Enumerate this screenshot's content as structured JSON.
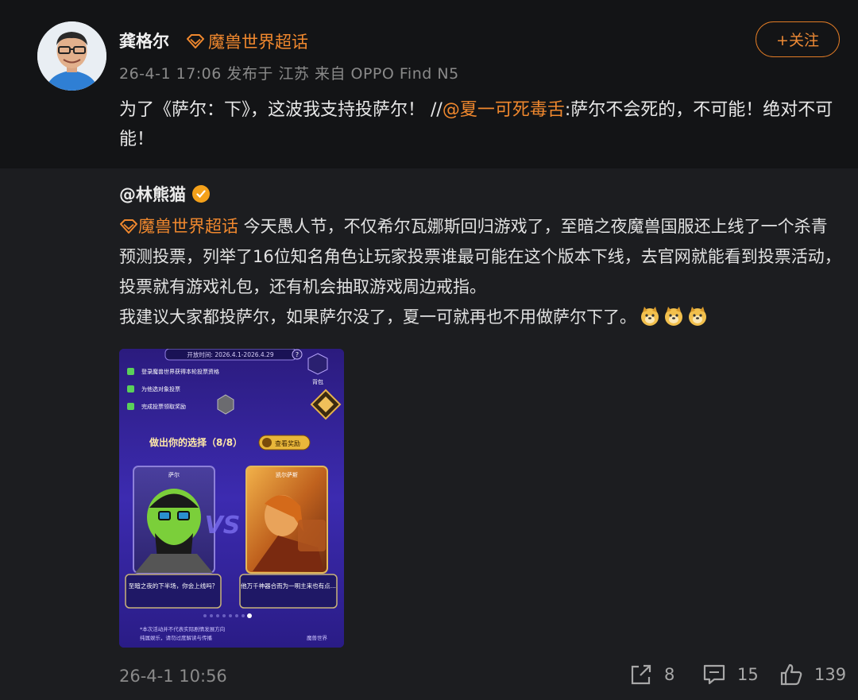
{
  "post": {
    "author": "龚格尔",
    "topic_badge": "魔兽世界超话",
    "meta": "26-4-1 17:06 发布于 江苏 来自 OPPO Find N5",
    "follow_label": "+关注",
    "text_prefix": "为了《萨尔：下》，这波我支持投萨尔！ //",
    "mention": "@夏一可死毒舌",
    "text_suffix": ":萨尔不会死的，不可能！绝对不可能！"
  },
  "repost": {
    "author": "@林熊猫",
    "topic": "魔兽世界超话",
    "text_1": " 今天愚人节，不仅希尔瓦娜斯回归游戏了，至暗之夜魔兽国服还上线了一个杀青预测投票，列举了16位知名角色让玩家投票谁最可能在这个版本下线，去官网就能看到投票活动，投票就有游戏礼包，还有机会抽取游戏周边戒指。",
    "text_2": "我建议大家都投萨尔，如果萨尔没了，夏一可就再也不用做萨尔下了。",
    "emoji_name": "doge-emoji",
    "time": "26-4-1 10:56",
    "actions": {
      "share_count": "8",
      "comment_count": "15",
      "like_count": "139"
    },
    "image": {
      "date_range": "开放时间: 2026.4.1-2026.4.29",
      "tasks": [
        "登录魔兽世界获得本轮投票资格",
        "为他选对象投票",
        "完成投票领取奖励"
      ],
      "title": "做出你的选择（8/8）",
      "back_btn": "查看奖励",
      "left_card": "萨尔",
      "right_card": "凯尔萨斯",
      "left_caption": "至暗之夜的下半场，你会上线吗？",
      "right_caption": "他万千神器合而为一明主来也有点...",
      "right_label": "背包",
      "note": "*本次活动并不代表实际剧情发展方向",
      "note2": "纯属娱乐，请勿过度解读与传播",
      "brand": "魔兽世界"
    }
  },
  "colors": {
    "accent": "#f0882e",
    "background": "#111214",
    "repost_bg": "#1c1d20"
  }
}
